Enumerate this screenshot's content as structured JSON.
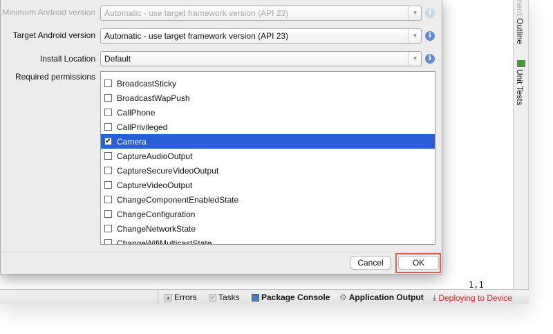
{
  "dialog": {
    "min_version": {
      "label": "Minimum Android version",
      "value": "Automatic - use target framework version (API 23)"
    },
    "target_version": {
      "label": "Target Android version",
      "value": "Automatic - use target framework version (API 23)"
    },
    "install_location": {
      "label": "Install Location",
      "value": "Default"
    },
    "permissions_label": "Required permissions",
    "permissions": [
      {
        "label": "BroadcastSticky",
        "checked": false
      },
      {
        "label": "BroadcastWapPush",
        "checked": false
      },
      {
        "label": "CallPhone",
        "checked": false
      },
      {
        "label": "CallPrivileged",
        "checked": false
      },
      {
        "label": "Camera",
        "checked": true
      },
      {
        "label": "CaptureAudioOutput",
        "checked": false
      },
      {
        "label": "CaptureSecureVideoOutput",
        "checked": false
      },
      {
        "label": "CaptureVideoOutput",
        "checked": false
      },
      {
        "label": "ChangeComponentEnabledState",
        "checked": false
      },
      {
        "label": "ChangeConfiguration",
        "checked": false
      },
      {
        "label": "ChangeNetworkState",
        "checked": false
      },
      {
        "label": "ChangeWifiMulticastState",
        "checked": false
      }
    ],
    "cancel": "Cancel",
    "ok": "OK"
  },
  "sidebar": {
    "outline_fade": "ment ",
    "outline": "Outline",
    "unit_tests": "Unit Tests"
  },
  "editor": {
    "cursor_position": "1,1"
  },
  "statusbar": {
    "errors": "Errors",
    "tasks": "Tasks",
    "package_console": "Package Console",
    "application_output": "Application Output",
    "deploying": "Deploying to Device"
  },
  "colors": {
    "selection": "#2a5fd8",
    "highlight": "#e0604c",
    "deploying": "#e02020"
  }
}
